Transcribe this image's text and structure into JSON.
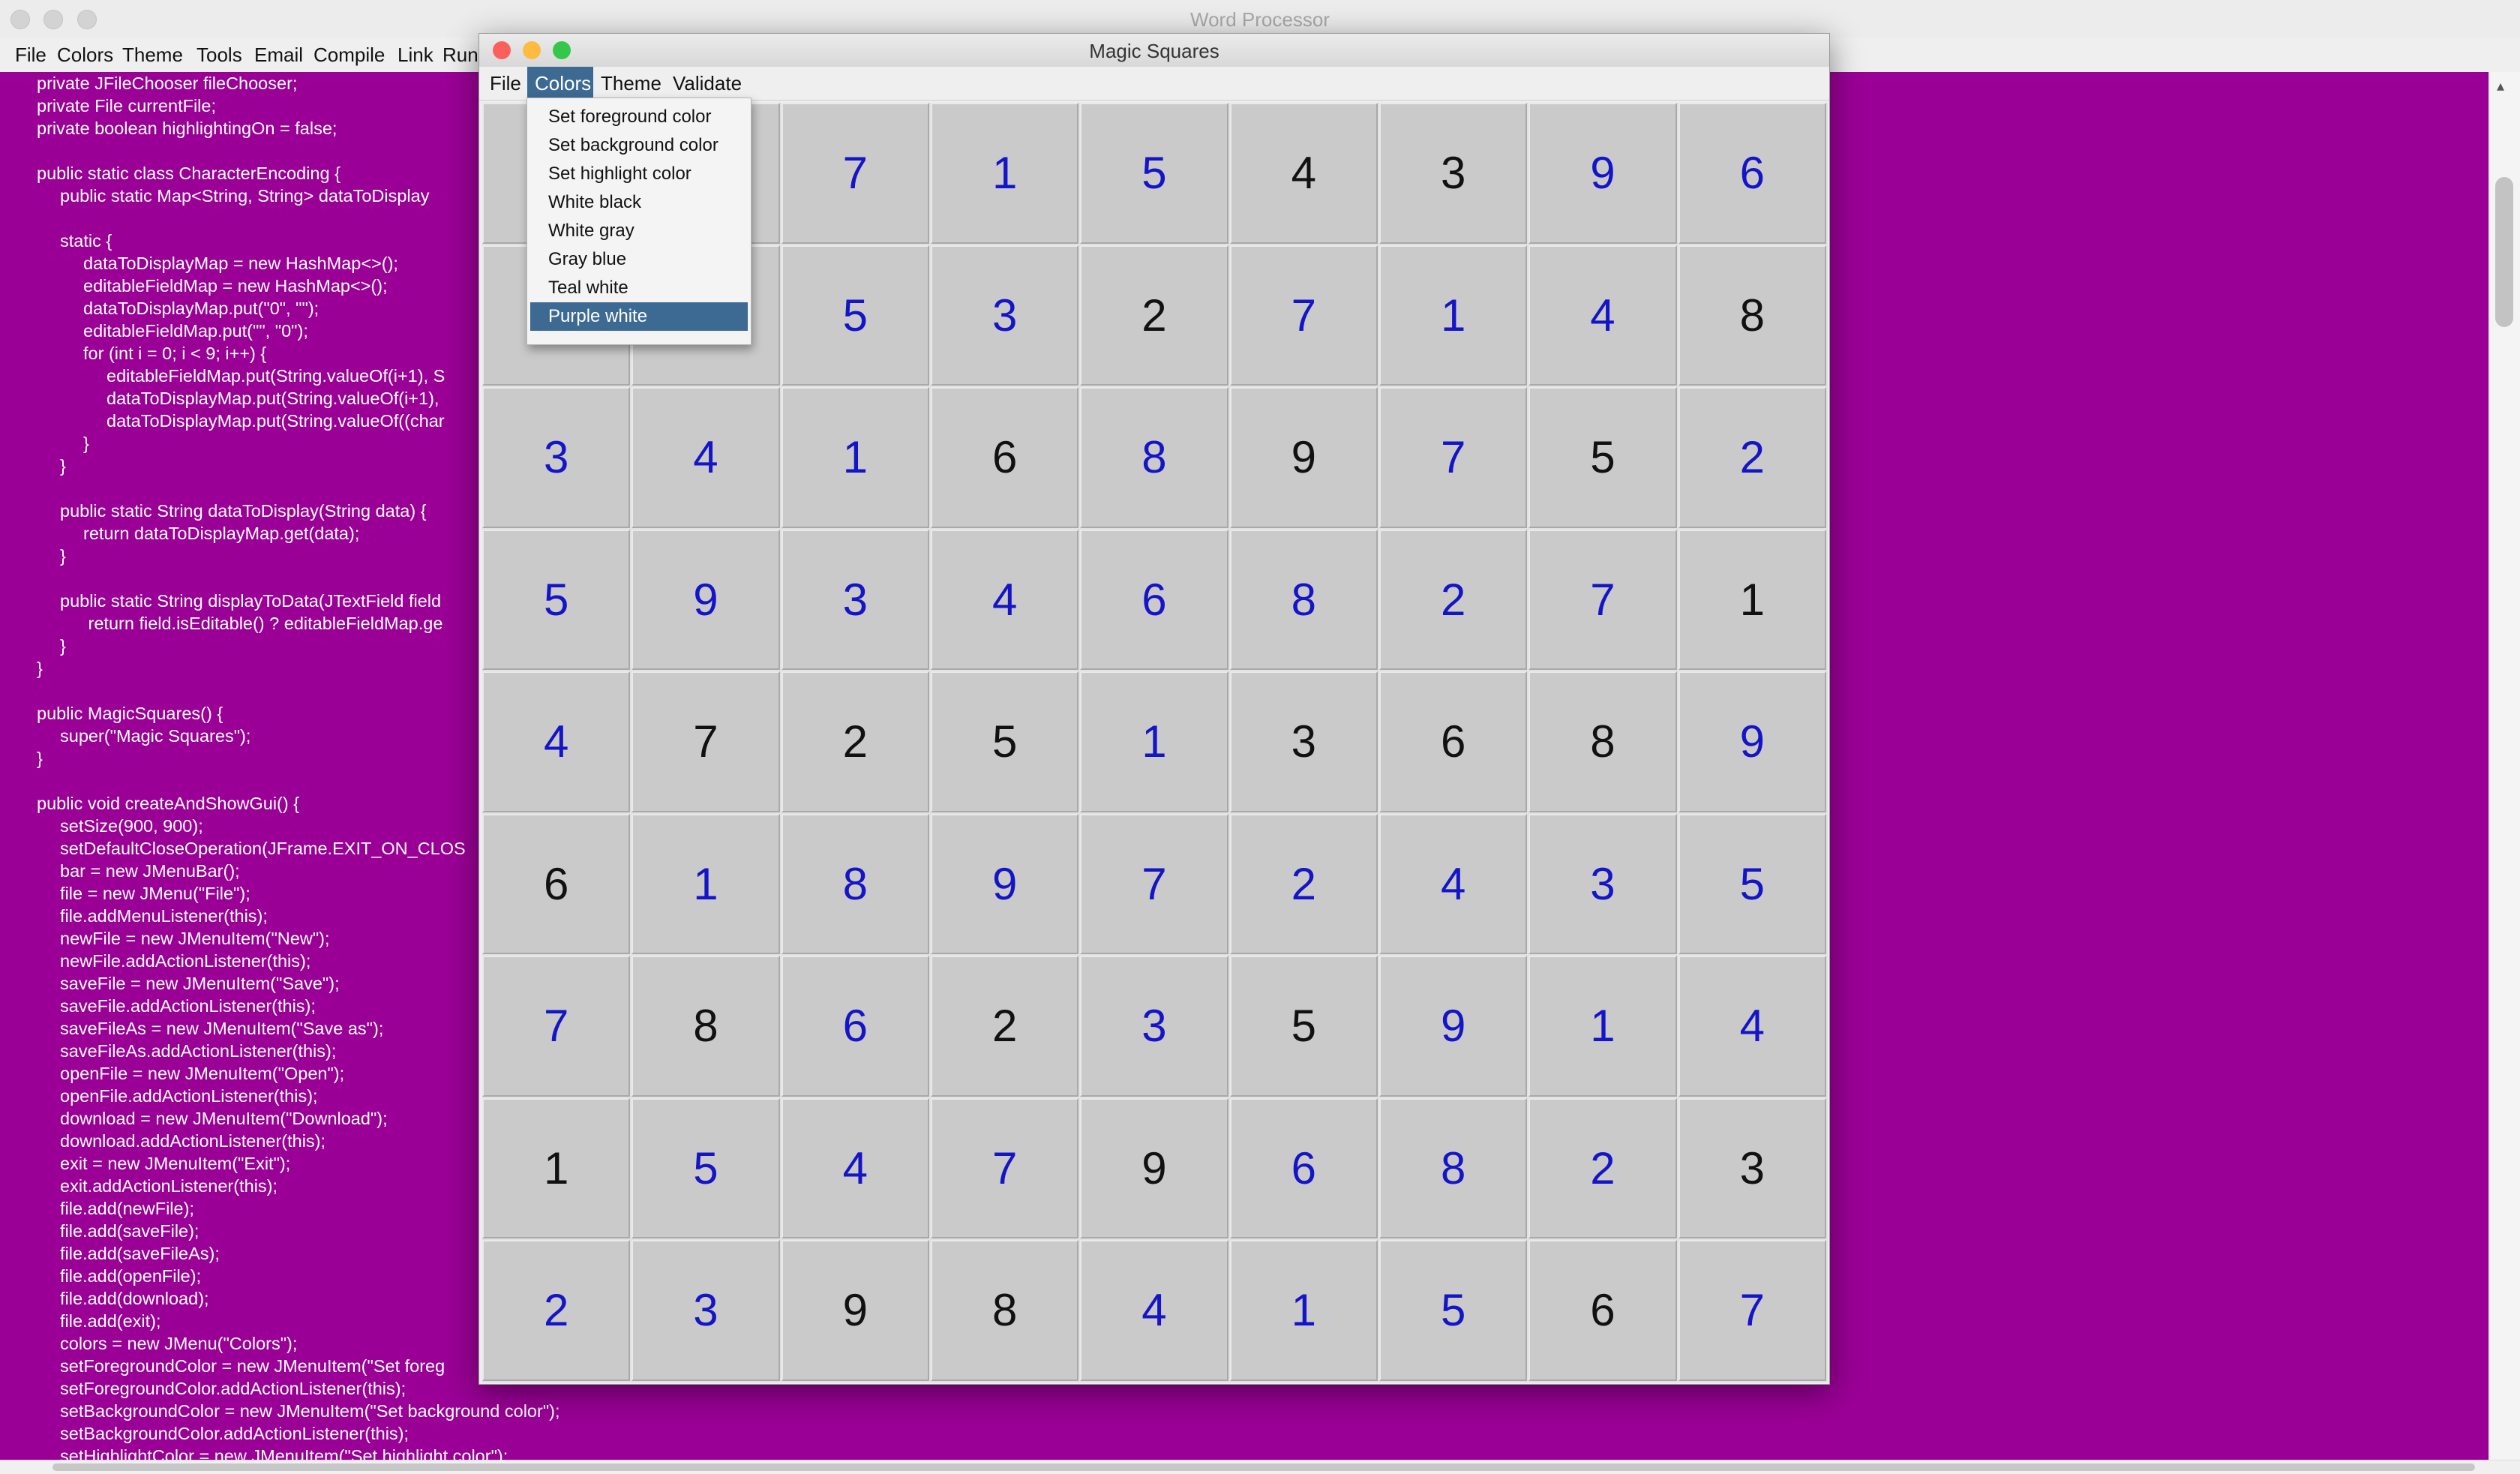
{
  "word_processor": {
    "title": "Word Processor",
    "menus": [
      "File",
      "Colors",
      "Theme",
      "Tools",
      "Email",
      "Compile",
      "Link",
      "Run"
    ],
    "code_lines": [
      {
        "indent": 1,
        "text": "private JFileChooser fileChooser;"
      },
      {
        "indent": 1,
        "text": "private File currentFile;"
      },
      {
        "indent": 1,
        "text": "private boolean highlightingOn = false;"
      },
      {
        "indent": 0,
        "text": ""
      },
      {
        "indent": 1,
        "text": "public static class CharacterEncoding {"
      },
      {
        "indent": 2,
        "text": "public static Map<String, String> dataToDisplay"
      },
      {
        "indent": 0,
        "text": ""
      },
      {
        "indent": 2,
        "text": "static {"
      },
      {
        "indent": 3,
        "text": "dataToDisplayMap = new HashMap<>();"
      },
      {
        "indent": 3,
        "text": "editableFieldMap = new HashMap<>();"
      },
      {
        "indent": 3,
        "text": "dataToDisplayMap.put(\"0\", \"\");"
      },
      {
        "indent": 3,
        "text": "editableFieldMap.put(\"\", \"0\");"
      },
      {
        "indent": 3,
        "text": "for (int i = 0; i < 9; i++) {"
      },
      {
        "indent": 4,
        "text": "editableFieldMap.put(String.valueOf(i+1), S"
      },
      {
        "indent": 4,
        "text": "dataToDisplayMap.put(String.valueOf(i+1),"
      },
      {
        "indent": 4,
        "text": "dataToDisplayMap.put(String.valueOf((char"
      },
      {
        "indent": 3,
        "text": "}"
      },
      {
        "indent": 2,
        "text": "}"
      },
      {
        "indent": 0,
        "text": ""
      },
      {
        "indent": 2,
        "text": "public static String dataToDisplay(String data) {"
      },
      {
        "indent": 3,
        "text": "return dataToDisplayMap.get(data);"
      },
      {
        "indent": 2,
        "text": "}"
      },
      {
        "indent": 0,
        "text": ""
      },
      {
        "indent": 2,
        "text": "public static String displayToData(JTextField field"
      },
      {
        "indent": 3,
        "text": " return field.isEditable() ? editableFieldMap.ge"
      },
      {
        "indent": 2,
        "text": "}"
      },
      {
        "indent": 1,
        "text": "}"
      },
      {
        "indent": 0,
        "text": ""
      },
      {
        "indent": 1,
        "text": "public MagicSquares() {"
      },
      {
        "indent": 2,
        "text": "super(\"Magic Squares\");"
      },
      {
        "indent": 1,
        "text": "}"
      },
      {
        "indent": 0,
        "text": ""
      },
      {
        "indent": 1,
        "text": "public void createAndShowGui() {"
      },
      {
        "indent": 2,
        "text": "setSize(900, 900);"
      },
      {
        "indent": 2,
        "text": "setDefaultCloseOperation(JFrame.EXIT_ON_CLOS"
      },
      {
        "indent": 2,
        "text": "bar = new JMenuBar();"
      },
      {
        "indent": 2,
        "text": "file = new JMenu(\"File\");"
      },
      {
        "indent": 2,
        "text": "file.addMenuListener(this);"
      },
      {
        "indent": 2,
        "text": "newFile = new JMenuItem(\"New\");"
      },
      {
        "indent": 2,
        "text": "newFile.addActionListener(this);"
      },
      {
        "indent": 2,
        "text": "saveFile = new JMenuItem(\"Save\");"
      },
      {
        "indent": 2,
        "text": "saveFile.addActionListener(this);"
      },
      {
        "indent": 2,
        "text": "saveFileAs = new JMenuItem(\"Save as\");"
      },
      {
        "indent": 2,
        "text": "saveFileAs.addActionListener(this);"
      },
      {
        "indent": 2,
        "text": "openFile = new JMenuItem(\"Open\");"
      },
      {
        "indent": 2,
        "text": "openFile.addActionListener(this);"
      },
      {
        "indent": 2,
        "text": "download = new JMenuItem(\"Download\");"
      },
      {
        "indent": 2,
        "text": "download.addActionListener(this);"
      },
      {
        "indent": 2,
        "text": "exit = new JMenuItem(\"Exit\");"
      },
      {
        "indent": 2,
        "text": "exit.addActionListener(this);"
      },
      {
        "indent": 2,
        "text": "file.add(newFile);"
      },
      {
        "indent": 2,
        "text": "file.add(saveFile);"
      },
      {
        "indent": 2,
        "text": "file.add(saveFileAs);"
      },
      {
        "indent": 2,
        "text": "file.add(openFile);"
      },
      {
        "indent": 2,
        "text": "file.add(download);"
      },
      {
        "indent": 2,
        "text": "file.add(exit);"
      },
      {
        "indent": 2,
        "text": "colors = new JMenu(\"Colors\");"
      },
      {
        "indent": 2,
        "text": "setForegroundColor = new JMenuItem(\"Set foreg"
      },
      {
        "indent": 2,
        "text": "setForegroundColor.addActionListener(this);"
      },
      {
        "indent": 2,
        "text": "setBackgroundColor = new JMenuItem(\"Set background color\");"
      },
      {
        "indent": 2,
        "text": "setBackgroundColor.addActionListener(this);"
      },
      {
        "indent": 2,
        "text": "setHighlightColor = new JMenuItem(\"Set highlight color\");"
      }
    ]
  },
  "magic_squares": {
    "title": "Magic Squares",
    "menus": [
      "File",
      "Colors",
      "Theme",
      "Validate"
    ],
    "active_menu": "Colors",
    "colors_menu": {
      "items": [
        "Set foreground color",
        "Set background color",
        "Set highlight color",
        "White black",
        "White gray",
        "Gray blue",
        "Teal white",
        "Purple white"
      ],
      "selected": "Purple white"
    },
    "grid": [
      [
        "",
        "",
        "7",
        "1",
        "5",
        "4",
        "3",
        "9",
        "6"
      ],
      [
        "",
        "",
        "5",
        "3",
        "2",
        "7",
        "1",
        "4",
        "8"
      ],
      [
        "3",
        "4",
        "1",
        "6",
        "8",
        "9",
        "7",
        "5",
        "2"
      ],
      [
        "5",
        "9",
        "3",
        "4",
        "6",
        "8",
        "2",
        "7",
        "1"
      ],
      [
        "4",
        "7",
        "2",
        "5",
        "1",
        "3",
        "6",
        "8",
        "9"
      ],
      [
        "6",
        "1",
        "8",
        "9",
        "7",
        "2",
        "4",
        "3",
        "5"
      ],
      [
        "7",
        "8",
        "6",
        "2",
        "3",
        "5",
        "9",
        "1",
        "4"
      ],
      [
        "1",
        "5",
        "4",
        "7",
        "9",
        "6",
        "8",
        "2",
        "3"
      ],
      [
        "2",
        "3",
        "9",
        "8",
        "4",
        "1",
        "5",
        "6",
        "7"
      ]
    ],
    "editable": [
      [
        1,
        1,
        1,
        1,
        1,
        0,
        0,
        1,
        1
      ],
      [
        1,
        1,
        1,
        1,
        0,
        1,
        1,
        1,
        0
      ],
      [
        1,
        1,
        1,
        0,
        1,
        0,
        1,
        0,
        1
      ],
      [
        1,
        1,
        1,
        1,
        1,
        1,
        1,
        1,
        0
      ],
      [
        1,
        0,
        0,
        0,
        1,
        0,
        0,
        0,
        1
      ],
      [
        0,
        1,
        1,
        1,
        1,
        1,
        1,
        1,
        1
      ],
      [
        1,
        0,
        1,
        0,
        1,
        0,
        1,
        1,
        1
      ],
      [
        0,
        1,
        1,
        1,
        0,
        1,
        1,
        1,
        0
      ],
      [
        1,
        1,
        0,
        0,
        1,
        1,
        1,
        0,
        1
      ]
    ]
  },
  "colors": {
    "editor_background": "#9a0096",
    "editor_text": "#ffffff",
    "cell_background": "#cacaca",
    "editable_digit": "#1414c8",
    "fixed_digit": "#111111",
    "menu_highlight": "#3d6a92",
    "close_light": "#fc605c",
    "minimize_light": "#fdbc40",
    "zoom_light": "#34c84a"
  }
}
